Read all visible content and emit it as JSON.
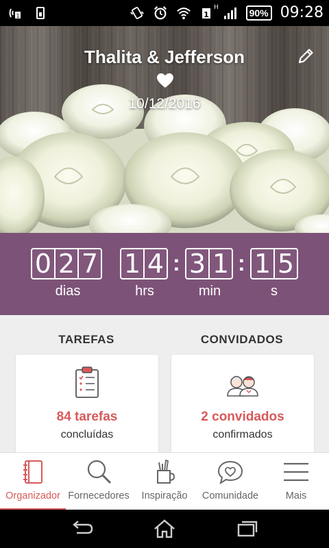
{
  "status_bar": {
    "battery": "90%",
    "time": "09:28",
    "network": "H",
    "icons": [
      "wireless-signal-icon",
      "sim-icon",
      "vibrate-icon",
      "alarm-icon",
      "wifi-icon",
      "sim-1-icon",
      "signal-icon",
      "battery-icon"
    ]
  },
  "header": {
    "couple_names": "Thalita & Jefferson",
    "wedding_date": "10/12/2016",
    "edit_icon": "pencil-icon",
    "heart_icon": "heart-icon"
  },
  "countdown": {
    "days": [
      "0",
      "2",
      "7"
    ],
    "hours": [
      "1",
      "4"
    ],
    "minutes": [
      "3",
      "1"
    ],
    "seconds": [
      "1",
      "5"
    ],
    "separator": ":",
    "labels": {
      "days": "dias",
      "hours": "hrs",
      "minutes": "min",
      "seconds": "s"
    }
  },
  "sections": {
    "tasks": {
      "title": "TAREFAS",
      "main": "84 tarefas",
      "sub": "concluídas",
      "icon": "clipboard-icon"
    },
    "guests": {
      "title": "CONVIDADOS",
      "main": "2 convidados",
      "sub": "confirmados",
      "icon": "couple-icon"
    }
  },
  "bottom_nav": {
    "items": [
      {
        "label": "Organizador",
        "icon": "notebook-icon",
        "active": true
      },
      {
        "label": "Fornecedores",
        "icon": "search-icon",
        "active": false
      },
      {
        "label": "Inspiração",
        "icon": "tools-cup-icon",
        "active": false
      },
      {
        "label": "Comunidade",
        "icon": "chat-heart-icon",
        "active": false
      },
      {
        "label": "Mais",
        "icon": "menu-icon",
        "active": false
      }
    ]
  },
  "colors": {
    "accent": "#d9595a",
    "countdown_bg": "#7d5278",
    "content_bg": "#eeeeee"
  }
}
